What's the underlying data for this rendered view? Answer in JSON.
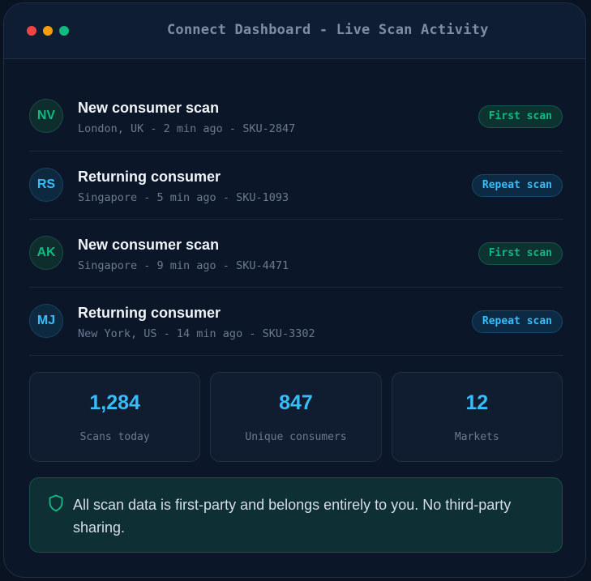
{
  "window": {
    "title": "Connect Dashboard - Live Scan Activity"
  },
  "scans": [
    {
      "initials": "NV",
      "title": "New consumer scan",
      "details": "London, UK - 2 min ago - SKU-2847",
      "badge": "First scan",
      "type": "first"
    },
    {
      "initials": "RS",
      "title": "Returning consumer",
      "details": "Singapore - 5 min ago - SKU-1093",
      "badge": "Repeat scan",
      "type": "repeat"
    },
    {
      "initials": "AK",
      "title": "New consumer scan",
      "details": "Singapore - 9 min ago - SKU-4471",
      "badge": "First scan",
      "type": "first"
    },
    {
      "initials": "MJ",
      "title": "Returning consumer",
      "details": "New York, US - 14 min ago - SKU-3302",
      "badge": "Repeat scan",
      "type": "repeat"
    }
  ],
  "stats": [
    {
      "value": "1,284",
      "label": "Scans today"
    },
    {
      "value": "847",
      "label": "Unique consumers"
    },
    {
      "value": "12",
      "label": "Markets"
    }
  ],
  "notice": {
    "icon": "shield-icon",
    "text": "All scan data is first-party and belongs entirely to you. No third-party sharing."
  },
  "colors": {
    "accent_blue": "#38bdf8",
    "accent_green": "#10b981",
    "background": "#0b1628"
  }
}
